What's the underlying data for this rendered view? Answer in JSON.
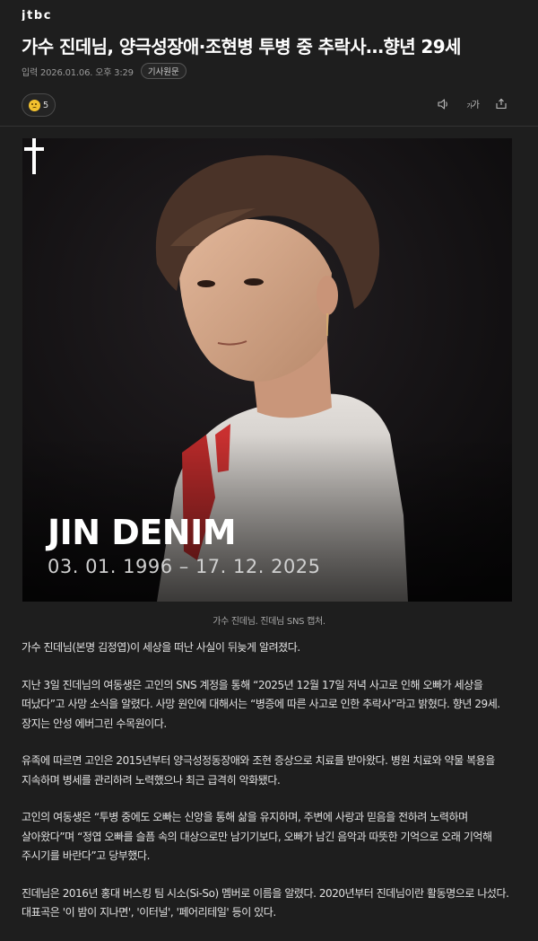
{
  "header": {
    "logo": "JTBC"
  },
  "article": {
    "title": "가수 진데님, 양극성장애·조현병 투병 중 추락사…향년 29세",
    "date": "입력 2026.01.06. 오후 3:29",
    "original_link_label": "기사원문",
    "reaction_count": "5",
    "font_size_label": "가",
    "image": {
      "memorial_name": "JIN DENIM",
      "memorial_dates": "03. 01. 1996 – 17. 12. 2025",
      "caption": "가수 진데님. 진데님 SNS 캡처."
    },
    "paragraphs": [
      "가수 진데님(본명 김정엽)이 세상을 떠난 사실이 뒤늦게 알려졌다.",
      "지난 3일 진데님의 여동생은 고인의 SNS 계정을 통해 “2025년 12월 17일 저녁 사고로 인해 오빠가 세상을 떠났다”고 사망 소식을 알렸다. 사망 원인에 대해서는 “병증에 따른 사고로 인한 추락사”라고 밝혔다. 향년 29세. 장지는 안성 에버그린 수목원이다.",
      "유족에 따르면 고인은 2015년부터 양극성정동장애와 조현 증상으로 치료를 받아왔다. 병원 치료와 약물 복용을 지속하며 병세를 관리하려 노력했으나 최근 급격히 악화됐다.",
      "고인의 여동생은 “투병 중에도 오빠는 신앙을 통해 삶을 유지하며, 주변에 사랑과 믿음을 전하려 노력하며 살아왔다”며 “정엽 오빠를 슬픔 속의 대상으로만 남기기보다, 오빠가 남긴 음악과 따뜻한 기억으로 오래 기억해 주시기를 바란다”고 당부했다.",
      "진데님은 2016년 홍대 버스킹 팀 시소(Si-So) 멤버로 이름을 알렸다. 2020년부터 진데님이란 활동명으로 나섰다. 대표곡은 '이 밤이 지나면', '이터널', '페어리테일' 등이 있다."
    ]
  },
  "icons": {
    "reaction": "sad-face-icon",
    "audio": "speaker-icon",
    "font": "font-size-icon",
    "share": "share-icon",
    "memorial": "cross-icon"
  },
  "colors": {
    "background": "#1e1e1e",
    "text": "#e6e6e6",
    "muted": "#9a9a9a"
  }
}
